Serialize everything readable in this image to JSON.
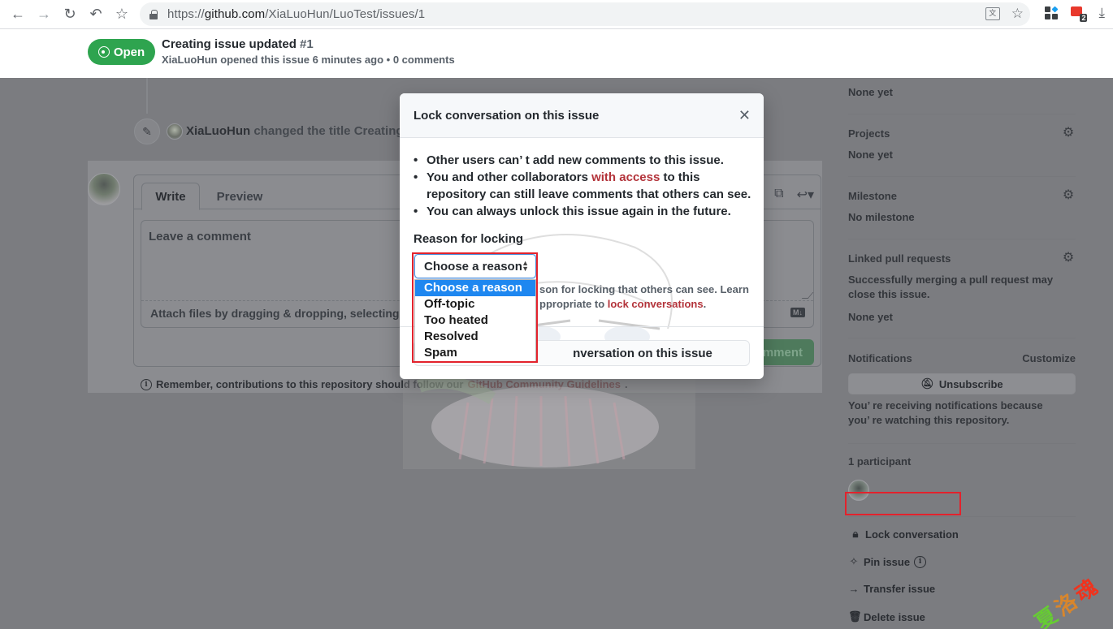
{
  "browser": {
    "url_prefix": "https://",
    "url_host": "github.com",
    "url_path": "/XiaLuoHun/LuoTest/issues/1",
    "extension_badge": "2"
  },
  "issue": {
    "state_label": "Open",
    "title": "Creating issue updated",
    "number": "#1",
    "meta": "XiaLuoHun opened this issue 6 minutes ago • 0 comments"
  },
  "timeline": {
    "event_user": "XiaLuoHun",
    "event_action": "changed the title",
    "event_title_fragment": "Creating"
  },
  "comment_form": {
    "tabs": [
      "Write",
      "Preview"
    ],
    "placeholder": "Leave a comment",
    "attach_text": "Attach files by dragging & dropping, selecting",
    "markdown_badge": "M↓",
    "submit_label": "Comment",
    "submit_visible_fragment": "mment",
    "remember_prefix": "Remember, contributions to this repository should follow our",
    "remember_link": "GitHub Community Guidelines",
    "remember_suffix": "."
  },
  "sidebar": {
    "labels_value": "None yet",
    "projects_heading": "Projects",
    "projects_value": "None yet",
    "milestone_heading": "Milestone",
    "milestone_value": "No milestone",
    "linked_heading": "Linked pull requests",
    "linked_desc_line1": "Successfully merging a pull request may",
    "linked_desc_line2": "close this issue.",
    "linked_value": "None yet",
    "notifications_heading": "Notifications",
    "customize_label": "Customize",
    "unsubscribe_label": "Unsubscribe",
    "notif_reason_line1": "You’ re receiving notifications because",
    "notif_reason_line2": "you’ re watching this repository.",
    "participants_heading": "1 participant",
    "actions": {
      "lock": "Lock conversation",
      "pin": "Pin issue",
      "transfer": "Transfer issue",
      "delete": "Delete issue"
    }
  },
  "modal": {
    "title": "Lock conversation on this issue",
    "bullet1": "Other users can’ t add new comments to this issue.",
    "bullet2_before": "You and other collaborators ",
    "bullet2_link": "with access",
    "bullet2_after": " to this repository can still leave comments that others can see.",
    "bullet3": "You can always unlock this issue again in the future.",
    "reason_label": "Reason for locking",
    "select_value": "Choose a reason",
    "help_visible_line1": "son for locking that others can see. Learn",
    "help_visible_line2_before": "ppropriate to ",
    "help_link": "lock conversations",
    "help_after": ".",
    "lock_button_visible": "nversation on this issue"
  },
  "dropdown": {
    "options": [
      "Choose a reason",
      "Off-topic",
      "Too heated",
      "Resolved",
      "Spam"
    ],
    "selected_index": 0
  },
  "watermark": [
    "夏",
    "洛",
    "魂"
  ],
  "colors": {
    "open_green": "#2ea44f",
    "link_red": "#b3333a",
    "select_highlight": "#1e87f0",
    "annotation_red": "#e3222c"
  }
}
